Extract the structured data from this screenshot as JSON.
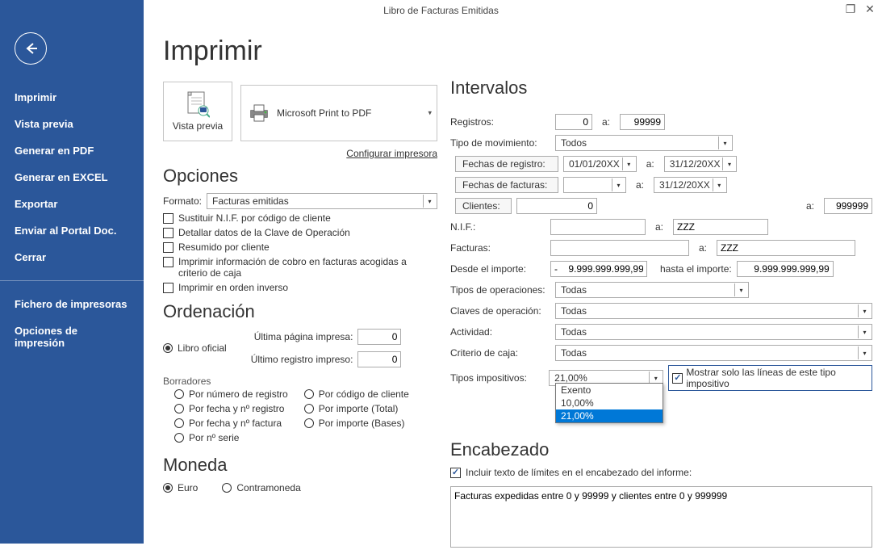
{
  "window": {
    "title": "Libro de Facturas Emitidas",
    "restore_icon": "❐",
    "close_icon": "✕"
  },
  "sidebar": {
    "items": [
      "Imprimir",
      "Vista previa",
      "Generar en PDF",
      "Generar en EXCEL",
      "Exportar",
      "Enviar al Portal Doc.",
      "Cerrar"
    ],
    "extra": [
      "Fichero de impresoras",
      "Opciones de impresión"
    ]
  },
  "page": {
    "title": "Imprimir",
    "preview_label": "Vista previa",
    "printer_name": "Microsoft Print to PDF",
    "config_printer": "Configurar impresora"
  },
  "options": {
    "heading": "Opciones",
    "format_label": "Formato:",
    "format_value": "Facturas emitidas",
    "chk_nif": "Sustituir N.I.F. por código de cliente",
    "chk_clave": "Detallar datos de la Clave de Operación",
    "chk_resumido": "Resumido por cliente",
    "chk_cobro": "Imprimir información de cobro en facturas acogidas a criterio de caja",
    "chk_inverso": "Imprimir en orden inverso"
  },
  "ordering": {
    "heading": "Ordenación",
    "oficial": "Libro oficial",
    "ultima_pagina_label": "Última página impresa:",
    "ultima_pagina_val": "0",
    "ultimo_reg_label": "Último registro impreso:",
    "ultimo_reg_val": "0",
    "borradores": "Borradores",
    "r_num_reg": "Por número de registro",
    "r_fecha_reg": "Por fecha y nº registro",
    "r_fecha_fac": "Por fecha y nº factura",
    "r_serie": "Por nº serie",
    "r_cod_cli": "Por código de cliente",
    "r_importe_total": "Por importe (Total)",
    "r_importe_bases": "Por importe (Bases)"
  },
  "currency": {
    "heading": "Moneda",
    "euro": "Euro",
    "contra": "Contramoneda"
  },
  "ranges": {
    "heading": "Intervalos",
    "registros_label": "Registros:",
    "registros_from": "0",
    "registros_to": "99999",
    "tipo_mov_label": "Tipo de movimiento:",
    "tipo_mov_val": "Todos",
    "fechas_reg_btn": "Fechas de registro:",
    "fechas_reg_from": "01/01/20XX",
    "fechas_reg_to": "31/12/20XX",
    "fechas_fac_btn": "Fechas de facturas:",
    "fechas_fac_from": "",
    "fechas_fac_to": "31/12/20XX",
    "clientes_btn": "Clientes:",
    "clientes_from": "0",
    "clientes_to": "999999",
    "nif_label": "N.I.F.:",
    "nif_from": "",
    "nif_to": "ZZZ",
    "facturas_label": "Facturas:",
    "facturas_from": "",
    "facturas_to": "ZZZ",
    "desde_imp_label": "Desde el importe:",
    "desde_imp_val": "-    9.999.999.999,99",
    "hasta_imp_label": "hasta el importe:",
    "hasta_imp_val": "9.999.999.999,99",
    "tipos_op_label": "Tipos de operaciones:",
    "tipos_op_val": "Todas",
    "claves_op_label": "Claves de operación:",
    "claves_op_val": "Todas",
    "actividad_label": "Actividad:",
    "actividad_val": "Todas",
    "criterio_label": "Criterio de caja:",
    "criterio_val": "Todas",
    "tipos_imp_label": "Tipos impositivos:",
    "tipos_imp_val": "21,00%",
    "tipos_imp_options": [
      "Exento",
      "10,00%",
      "21,00%"
    ],
    "chk_solo_lineas": "Mostrar solo las líneas de este tipo impositivo",
    "a": "a:"
  },
  "header": {
    "heading": "Encabezado",
    "chk_incluir": "Incluir texto de límites en el encabezado del informe:",
    "text": "Facturas expedidas entre 0 y 99999 y clientes entre 0 y 999999"
  }
}
